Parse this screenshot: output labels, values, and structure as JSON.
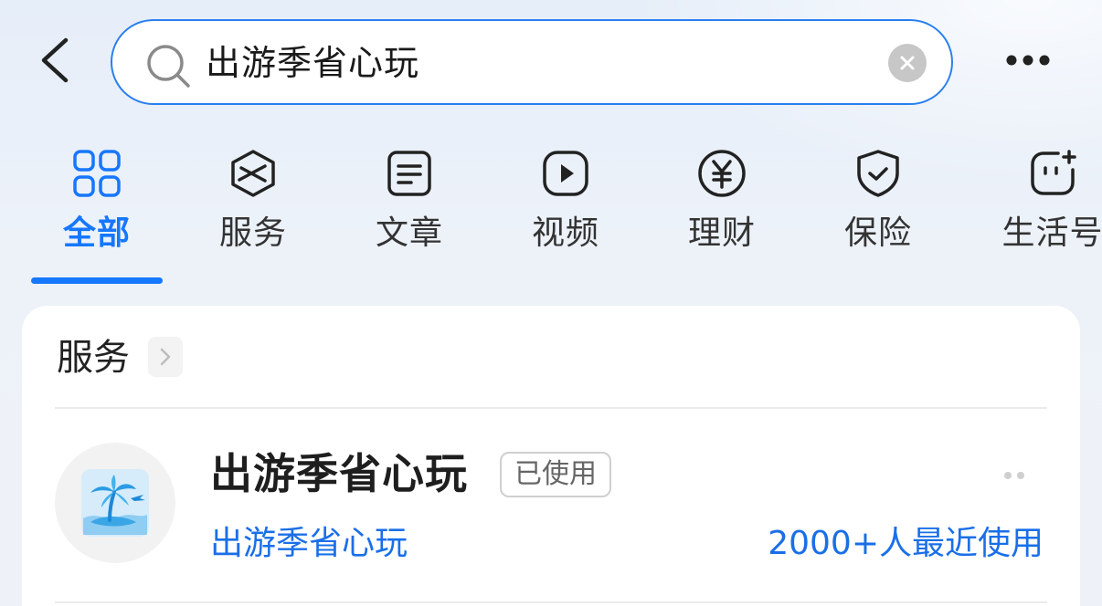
{
  "header": {
    "search_value": "出游季省心玩"
  },
  "tabs": [
    {
      "label": "全部",
      "icon": "grid-icon",
      "active": true
    },
    {
      "label": "服务",
      "icon": "service-cube-icon",
      "active": false
    },
    {
      "label": "文章",
      "icon": "article-icon",
      "active": false
    },
    {
      "label": "视频",
      "icon": "video-play-icon",
      "active": false
    },
    {
      "label": "理财",
      "icon": "yuan-coin-icon",
      "active": false
    },
    {
      "label": "保险",
      "icon": "shield-check-icon",
      "active": false
    },
    {
      "label": "生活号",
      "icon": "life-account-icon",
      "active": false
    }
  ],
  "section": {
    "title": "服务",
    "result": {
      "title": "出游季省心玩",
      "badge": "已使用",
      "subtitle": "出游季省心玩",
      "usage": "2000+人最近使用",
      "logo_icon": "palm-island-icon"
    }
  },
  "colors": {
    "accent": "#1677ff",
    "link": "#1a6fe8",
    "search_border": "#2a7ff0"
  }
}
